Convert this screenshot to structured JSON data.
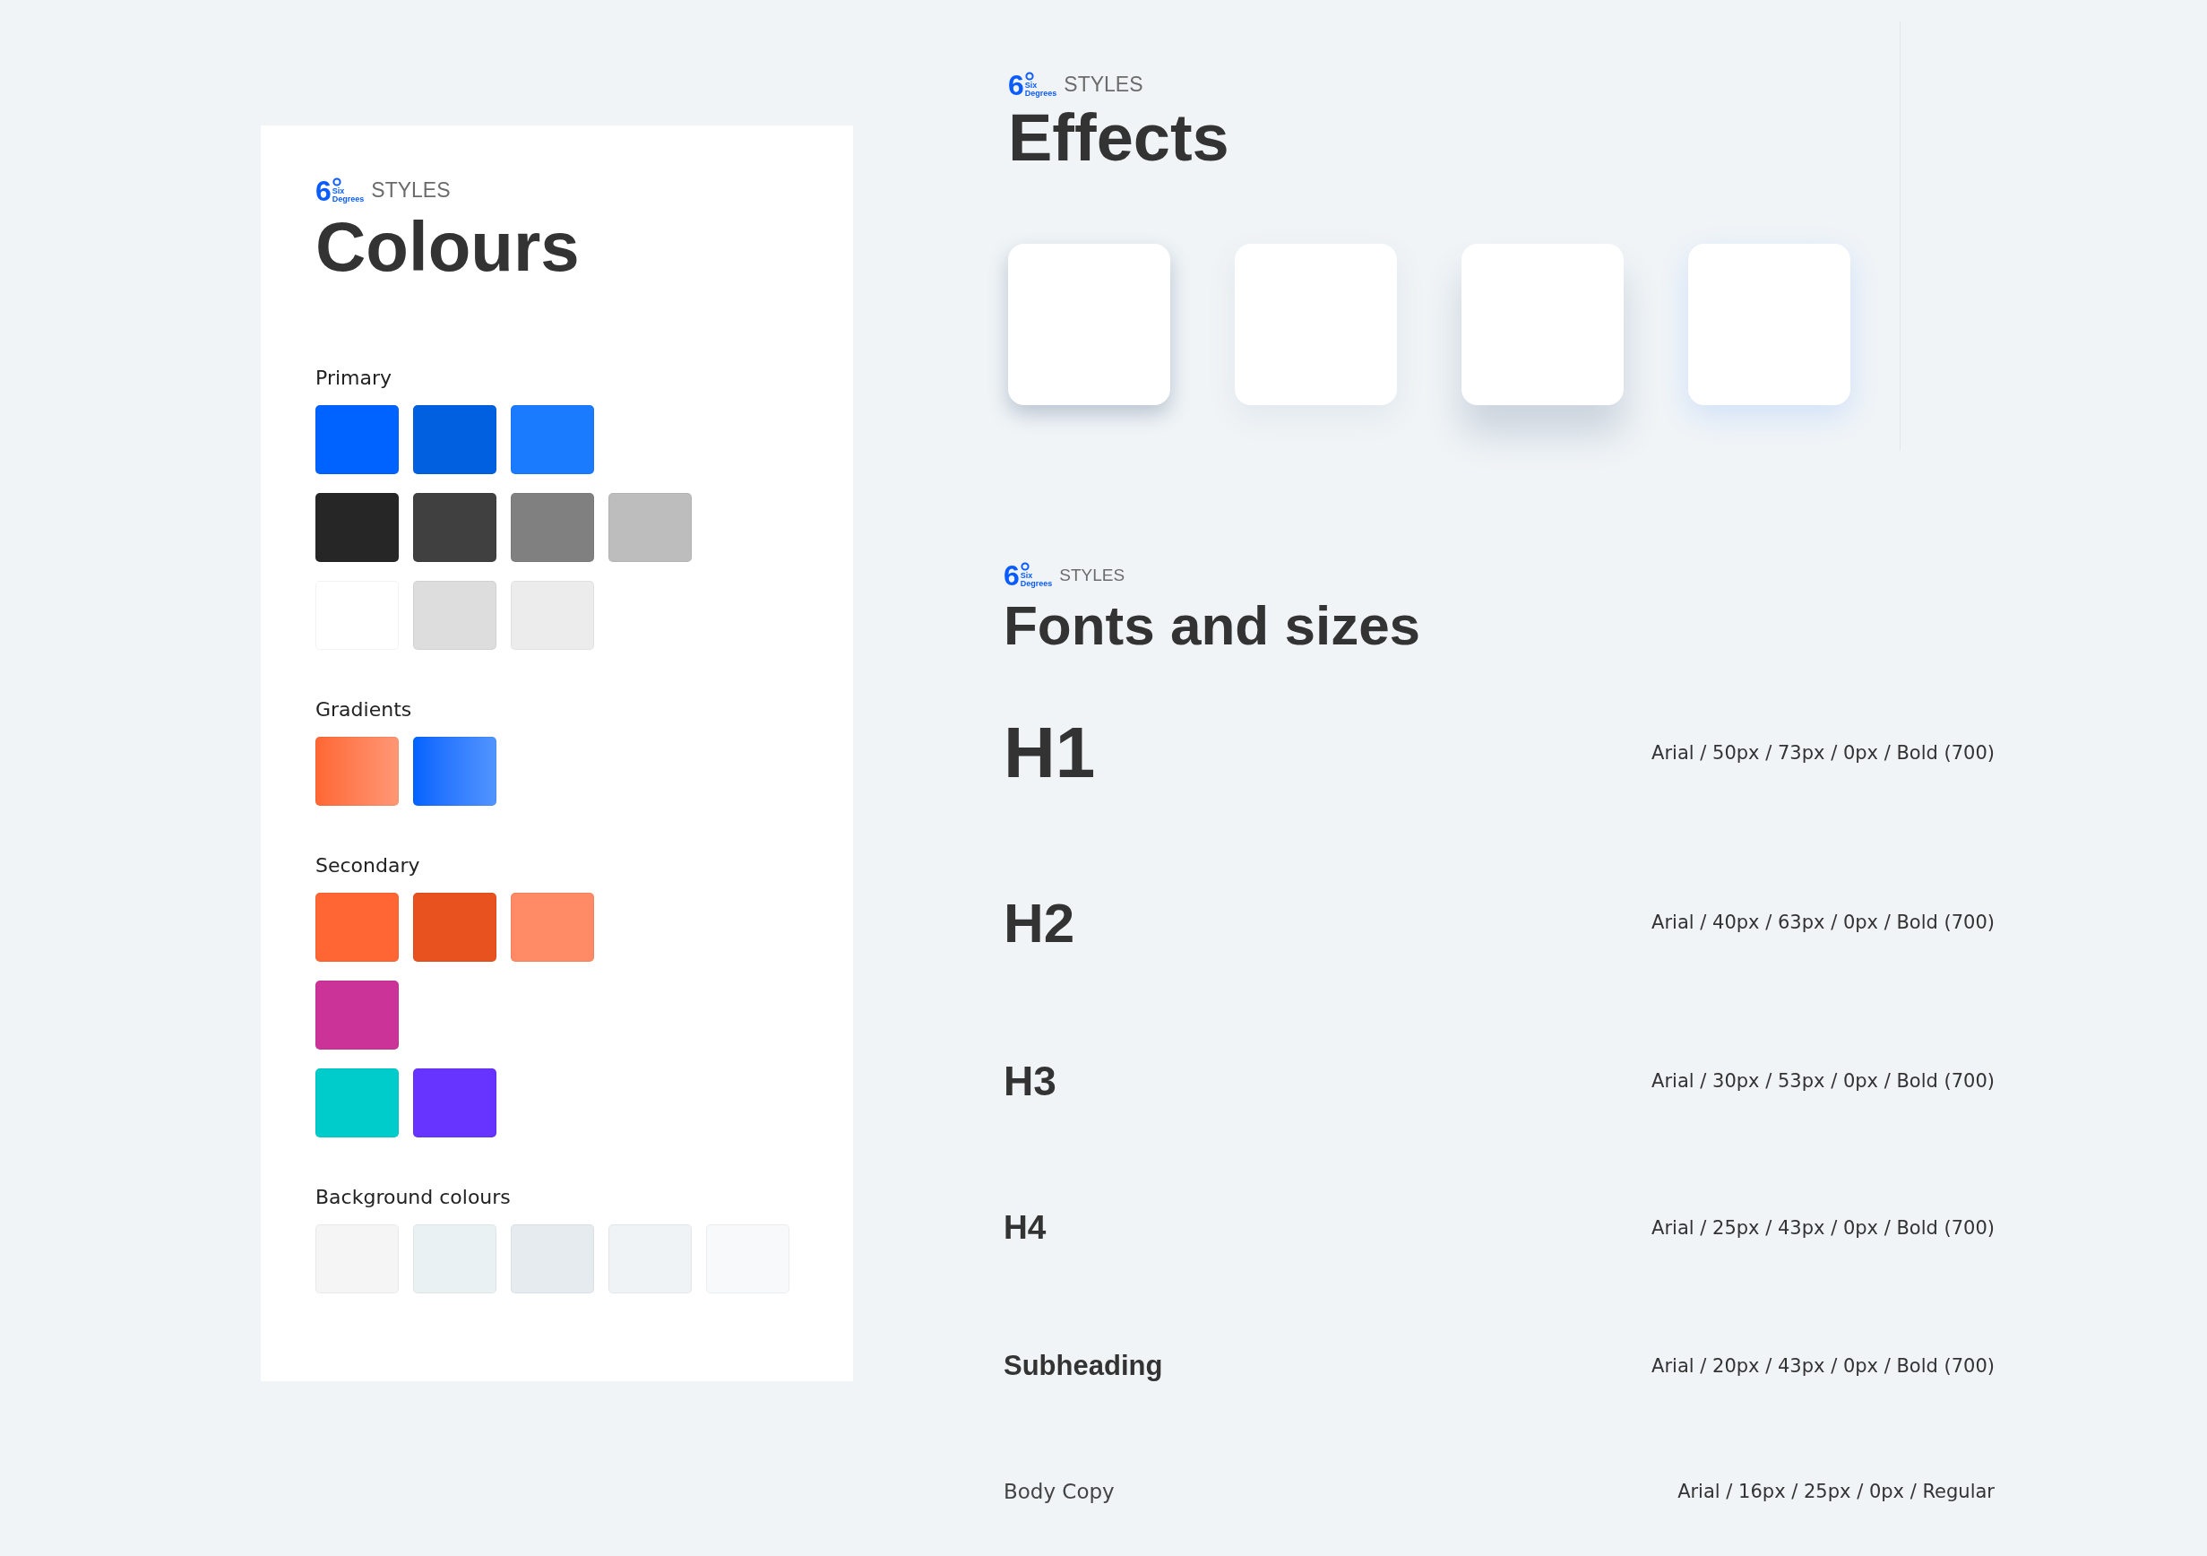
{
  "colours_panel": {
    "logo": {
      "mark": "6",
      "line1": "Six",
      "line2": "Degrees"
    },
    "eyebrow": "STYLES",
    "title": "Colours",
    "sections": [
      {
        "title": "Primary",
        "rows": [
          [
            {
              "color": "#0062ff"
            },
            {
              "color": "#0060e0"
            },
            {
              "color": "#1a7bff"
            }
          ],
          [
            {
              "color": "#262626"
            },
            {
              "color": "#404040"
            },
            {
              "color": "#808080"
            },
            {
              "color": "#bdbdbd"
            }
          ],
          [
            {
              "color": "#ffffff"
            },
            {
              "color": "#dddddd"
            },
            {
              "color": "#ececec"
            }
          ]
        ]
      },
      {
        "title": "Gradients",
        "kind": "gradient",
        "rows": [
          [
            {
              "color": "#ff6633"
            },
            {
              "color": "#0062ff"
            }
          ]
        ]
      },
      {
        "title": "Secondary",
        "rows": [
          [
            {
              "color": "#ff6633"
            },
            {
              "color": "#e8521f"
            },
            {
              "color": "#ff8a65"
            }
          ],
          [
            {
              "color": "#cc3399"
            }
          ],
          [
            {
              "color": "#00cccc"
            },
            {
              "color": "#6633ff"
            }
          ]
        ]
      },
      {
        "title": "Background colours",
        "rows": [
          [
            {
              "color": "#f5f5f5"
            },
            {
              "color": "#e9f1f3"
            },
            {
              "color": "#e5ebef"
            },
            {
              "color": "#eff3f6"
            },
            {
              "color": "#f7f9fb"
            }
          ]
        ]
      }
    ]
  },
  "effects_panel": {
    "logo": {
      "mark": "6",
      "line1": "Six",
      "line2": "Degrees"
    },
    "eyebrow": "STYLES",
    "title": "Effects",
    "cards": [
      {
        "kind": "sharp"
      },
      {
        "kind": "soft"
      },
      {
        "kind": "deep"
      },
      {
        "kind": "glow"
      }
    ]
  },
  "fonts_panel": {
    "logo": {
      "mark": "6",
      "line1": "Six",
      "line2": "Degrees"
    },
    "eyebrow": "STYLES",
    "title": "Fonts and sizes",
    "rows": [
      {
        "kind": "h1",
        "sample": "H1",
        "spec": "Arial / 50px / 73px / 0px / Bold (700)"
      },
      {
        "kind": "h2",
        "sample": "H2",
        "spec": "Arial / 40px / 63px / 0px / Bold (700)"
      },
      {
        "kind": "h3",
        "sample": "H3",
        "spec": "Arial / 30px / 53px / 0px / Bold (700)"
      },
      {
        "kind": "h4",
        "sample": "H4",
        "spec": "Arial / 25px / 43px / 0px / Bold (700)"
      },
      {
        "kind": "subheading",
        "sample": "Subheading",
        "spec": "Arial / 20px / 43px / 0px / Bold (700)"
      },
      {
        "kind": "body",
        "sample": "Body Copy",
        "spec": "Arial / 16px / 25px / 0px / Regular"
      }
    ]
  }
}
